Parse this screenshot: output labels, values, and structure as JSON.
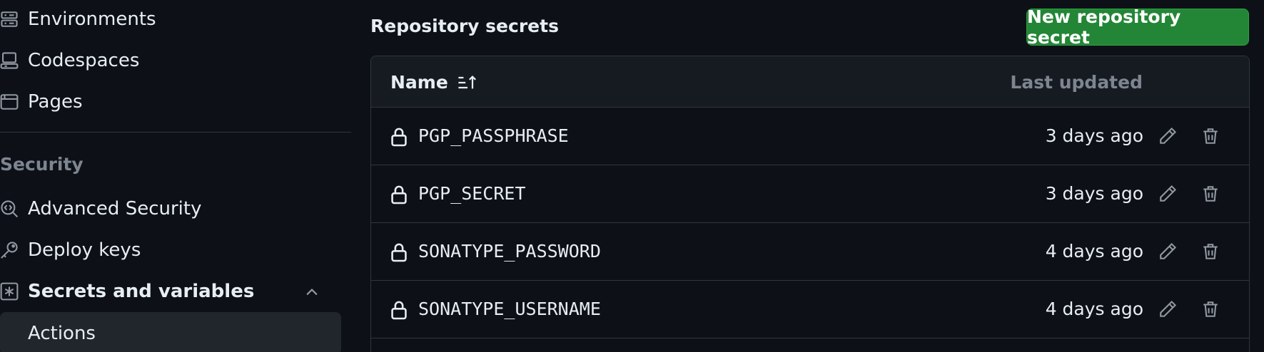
{
  "sidebar": {
    "items": [
      {
        "label": "Environments",
        "icon": "server-icon"
      },
      {
        "label": "Codespaces",
        "icon": "codespaces-icon"
      },
      {
        "label": "Pages",
        "icon": "browser-icon"
      }
    ],
    "security_heading": "Security",
    "security_items": [
      {
        "label": "Advanced Security",
        "icon": "codescan-icon"
      },
      {
        "label": "Deploy keys",
        "icon": "key-icon"
      },
      {
        "label": "Secrets and variables",
        "icon": "asterisk-icon",
        "expanded": true
      }
    ],
    "sub_items": [
      {
        "label": "Actions",
        "selected": true
      }
    ]
  },
  "main": {
    "title": "Repository secrets",
    "new_button_label": "New repository secret",
    "table": {
      "col_name": "Name",
      "col_updated": "Last updated",
      "rows": [
        {
          "name": "PGP_PASSPHRASE",
          "updated": "3 days ago"
        },
        {
          "name": "PGP_SECRET",
          "updated": "3 days ago"
        },
        {
          "name": "SONATYPE_PASSWORD",
          "updated": "4 days ago"
        },
        {
          "name": "SONATYPE_USERNAME",
          "updated": "4 days ago"
        }
      ]
    }
  },
  "colors": {
    "background": "#0d1117",
    "primary_button": "#238636",
    "muted_text": "#7d8590",
    "border": "#30363d"
  }
}
